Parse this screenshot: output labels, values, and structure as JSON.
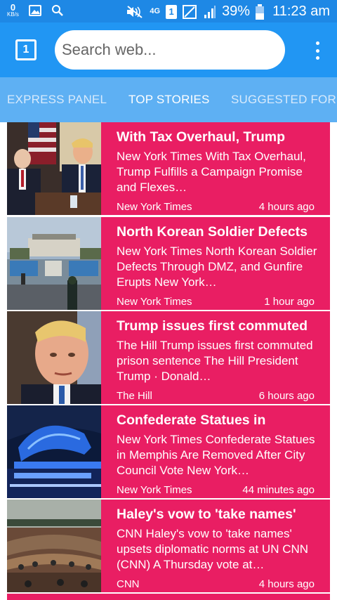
{
  "status_bar": {
    "speed_value": "0",
    "speed_unit": "KB/s",
    "network": "4G",
    "sim": "1",
    "battery": "39%",
    "time": "11:23 am",
    "icons": [
      "image-icon",
      "search-icon",
      "mute-icon",
      "sim-icon",
      "signal-icon",
      "battery-icon"
    ]
  },
  "toolbar": {
    "tab_count": "1",
    "search_placeholder": "Search web..."
  },
  "tabs": [
    {
      "label": "EXPRESS PANEL"
    },
    {
      "label": "TOP STORIES"
    },
    {
      "label": "SUGGESTED FOR Y"
    }
  ],
  "stories": [
    {
      "title": "With Tax Overhaul, Trump",
      "description": "New York Times With Tax Overhaul, Trump Fulfills a Campaign Promise and Flexes…",
      "source": "New York Times",
      "time": "4 hours ago"
    },
    {
      "title": "North Korean Soldier Defects",
      "description": "New York Times North Korean Soldier Defects Through DMZ, and Gunfire Erupts New York…",
      "source": "New York Times",
      "time": "1 hour ago"
    },
    {
      "title": "Trump issues first commuted",
      "description": "The Hill Trump issues first commuted prison sentence The Hill President Trump · Donald…",
      "source": "The Hill",
      "time": "6 hours ago"
    },
    {
      "title": "Confederate Statues in",
      "description": "New York Times Confederate Statues in Memphis Are Removed After City Council Vote New York…",
      "source": "New York Times",
      "time": "44 minutes ago"
    },
    {
      "title": "Haley's vow to 'take names'",
      "description": "CNN Haley's vow to 'take names' upsets diplomatic norms at UN CNN (CNN) A Thursday vote at…",
      "source": "CNN",
      "time": "4 hours ago"
    }
  ],
  "colors": {
    "status_bar": "#1e88e5",
    "toolbar": "#2196f3",
    "tabs_bg": "#5eb0f3",
    "card": "#e91e63"
  }
}
